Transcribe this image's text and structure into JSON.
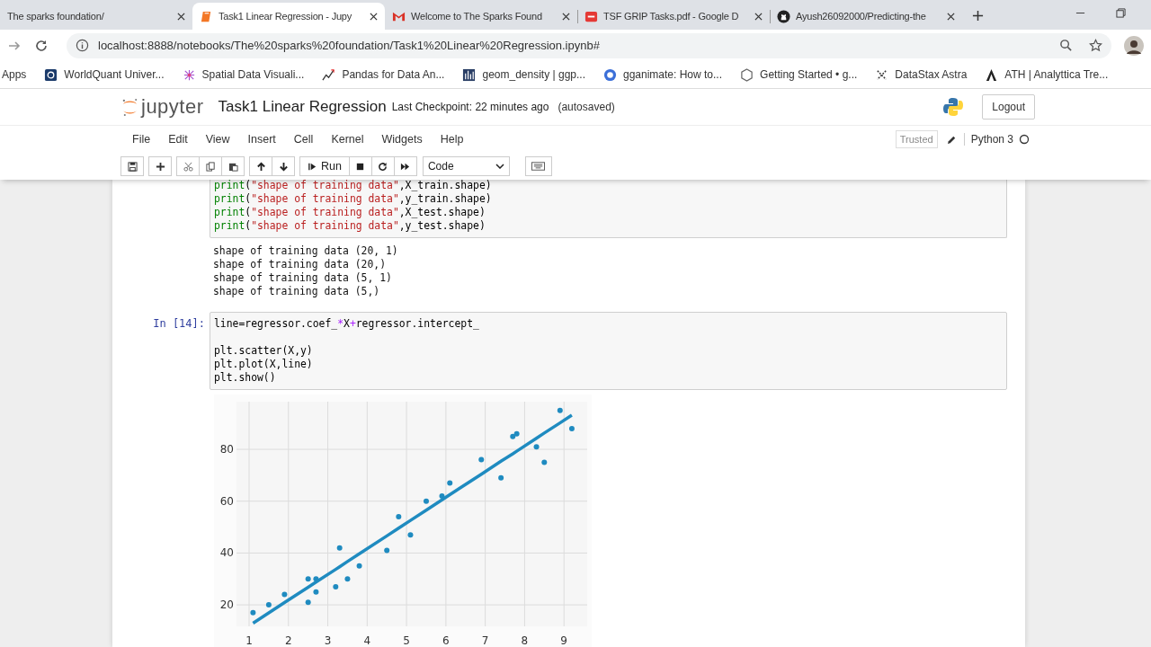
{
  "browser": {
    "tabs": [
      {
        "title": "The sparks foundation/",
        "selected": false
      },
      {
        "title": "Task1 Linear Regression - Jupy",
        "selected": true
      },
      {
        "title": "Welcome to The Sparks Found",
        "selected": false
      },
      {
        "title": "TSF GRIP Tasks.pdf - Google D",
        "selected": false
      },
      {
        "title": "Ayush26092000/Predicting-the",
        "selected": false
      }
    ],
    "address": "localhost:8888/notebooks/The%20sparks%20foundation/Task1%20Linear%20Regression.ipynb#",
    "bookmarks": [
      "Apps",
      "WorldQuant Univer...",
      "Spatial Data Visuali...",
      "Pandas for Data An...",
      "geom_density | ggp...",
      "gganimate: How to...",
      "Getting Started • g...",
      "DataStax Astra",
      "ATH | Analyttica Tre..."
    ]
  },
  "header": {
    "logo": "jupyter",
    "title": "Task1 Linear Regression",
    "checkpoint": "Last Checkpoint: 22 minutes ago",
    "autosave": "(autosaved)",
    "logout": "Logout"
  },
  "menu": [
    "File",
    "Edit",
    "View",
    "Insert",
    "Cell",
    "Kernel",
    "Widgets",
    "Help"
  ],
  "status": {
    "trusted": "Trusted",
    "kernel": "Python 3",
    "busy": false
  },
  "toolbar": {
    "run": "Run",
    "cell_type": "Code"
  },
  "cells": [
    {
      "input": [
        {
          "blank_before": false,
          "tokens": [
            {
              "kind": "builtin",
              "text": "print"
            },
            {
              "kind": "plain",
              "text": "("
            },
            {
              "kind": "string",
              "text": "\"shape of training data\""
            },
            {
              "kind": "plain",
              "text": ",X_train.shape)"
            }
          ]
        },
        {
          "blank_before": false,
          "tokens": [
            {
              "kind": "builtin",
              "text": "print"
            },
            {
              "kind": "plain",
              "text": "("
            },
            {
              "kind": "string",
              "text": "\"shape of training data\""
            },
            {
              "kind": "plain",
              "text": ",y_train.shape)"
            }
          ]
        },
        {
          "blank_before": false,
          "tokens": [
            {
              "kind": "builtin",
              "text": "print"
            },
            {
              "kind": "plain",
              "text": "("
            },
            {
              "kind": "string",
              "text": "\"shape of training data\""
            },
            {
              "kind": "plain",
              "text": ",X_test.shape)"
            }
          ]
        },
        {
          "blank_before": false,
          "tokens": [
            {
              "kind": "builtin",
              "text": "print"
            },
            {
              "kind": "plain",
              "text": "("
            },
            {
              "kind": "string",
              "text": "\"shape of training data\""
            },
            {
              "kind": "plain",
              "text": ",y_test.shape)"
            }
          ]
        }
      ],
      "output": {
        "kind": "text",
        "lines": [
          "shape of training data (20, 1)",
          "shape of training data (20,)",
          "shape of training data (5, 1)",
          "shape of training data (5,)"
        ]
      }
    },
    {
      "prompt": "In [14]:",
      "input": [
        {
          "blank_before": false,
          "tokens": [
            {
              "kind": "plain",
              "text": "line=regressor.coef_"
            },
            {
              "kind": "operator",
              "text": "*"
            },
            {
              "kind": "plain",
              "text": "X"
            },
            {
              "kind": "operator",
              "text": "+"
            },
            {
              "kind": "plain",
              "text": "regressor.intercept_"
            }
          ]
        },
        {
          "blank_before": true,
          "tokens": [
            {
              "kind": "plain",
              "text": "plt.scatter(X,y)"
            }
          ]
        },
        {
          "blank_before": false,
          "tokens": [
            {
              "kind": "plain",
              "text": "plt.plot(X,line)"
            }
          ]
        },
        {
          "blank_before": false,
          "tokens": [
            {
              "kind": "plain",
              "text": "plt.show()"
            }
          ]
        }
      ],
      "output": {
        "kind": "chart",
        "chart_data": {
          "type": "scatter",
          "grid": true,
          "xlim": [
            0.68,
            9.59
          ],
          "ylim": [
            11.7,
            98.4
          ],
          "xticks": [
            1,
            2,
            3,
            4,
            5,
            6,
            7,
            8,
            9
          ],
          "yticks": [
            20,
            40,
            60,
            80
          ],
          "x": [
            2.5,
            5.1,
            3.2,
            8.5,
            3.5,
            1.5,
            9.2,
            5.5,
            8.3,
            2.7,
            7.7,
            5.9,
            4.5,
            3.3,
            1.1,
            8.9,
            2.5,
            1.9,
            6.1,
            7.4,
            2.7,
            4.8,
            3.8,
            6.9,
            7.8
          ],
          "series": [
            {
              "type": "scatter",
              "color": "#1f8bc0",
              "values": [
                21,
                47,
                27,
                75,
                30,
                20,
                88,
                60,
                81,
                25,
                85,
                62,
                41,
                42,
                17,
                95,
                30,
                24,
                67,
                69,
                30,
                54,
                35,
                76,
                86
              ]
            },
            {
              "type": "line",
              "color": "#1f8bc0",
              "values": [
                26.8,
                52.6,
                33.7,
                86.3,
                36.7,
                16.9,
                93.2,
                56.5,
                84.3,
                28.8,
                78.3,
                60.5,
                46.6,
                34.7,
                12.9,
                90.2,
                26.8,
                20.9,
                62.5,
                75.4,
                28.8,
                49.6,
                39.7,
                70.4,
                79.3
              ]
            }
          ]
        }
      }
    }
  ]
}
